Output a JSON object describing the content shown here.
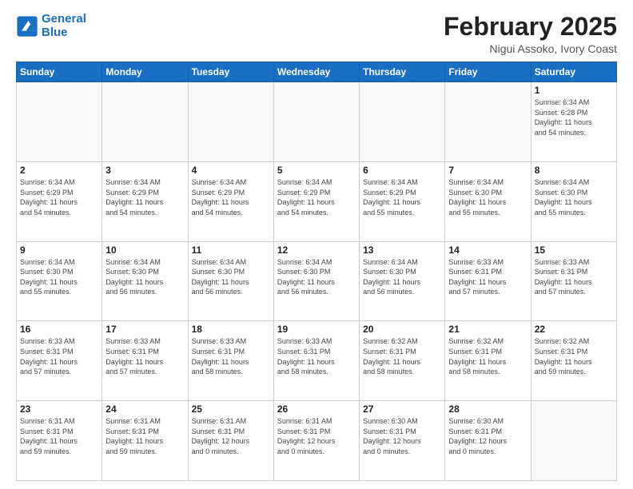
{
  "logo": {
    "line1": "General",
    "line2": "Blue"
  },
  "header": {
    "month": "February 2025",
    "location": "Nigui Assoko, Ivory Coast"
  },
  "weekdays": [
    "Sunday",
    "Monday",
    "Tuesday",
    "Wednesday",
    "Thursday",
    "Friday",
    "Saturday"
  ],
  "weeks": [
    [
      {
        "day": "",
        "info": ""
      },
      {
        "day": "",
        "info": ""
      },
      {
        "day": "",
        "info": ""
      },
      {
        "day": "",
        "info": ""
      },
      {
        "day": "",
        "info": ""
      },
      {
        "day": "",
        "info": ""
      },
      {
        "day": "1",
        "info": "Sunrise: 6:34 AM\nSunset: 6:28 PM\nDaylight: 11 hours\nand 54 minutes."
      }
    ],
    [
      {
        "day": "2",
        "info": "Sunrise: 6:34 AM\nSunset: 6:29 PM\nDaylight: 11 hours\nand 54 minutes."
      },
      {
        "day": "3",
        "info": "Sunrise: 6:34 AM\nSunset: 6:29 PM\nDaylight: 11 hours\nand 54 minutes."
      },
      {
        "day": "4",
        "info": "Sunrise: 6:34 AM\nSunset: 6:29 PM\nDaylight: 11 hours\nand 54 minutes."
      },
      {
        "day": "5",
        "info": "Sunrise: 6:34 AM\nSunset: 6:29 PM\nDaylight: 11 hours\nand 54 minutes."
      },
      {
        "day": "6",
        "info": "Sunrise: 6:34 AM\nSunset: 6:29 PM\nDaylight: 11 hours\nand 55 minutes."
      },
      {
        "day": "7",
        "info": "Sunrise: 6:34 AM\nSunset: 6:30 PM\nDaylight: 11 hours\nand 55 minutes."
      },
      {
        "day": "8",
        "info": "Sunrise: 6:34 AM\nSunset: 6:30 PM\nDaylight: 11 hours\nand 55 minutes."
      }
    ],
    [
      {
        "day": "9",
        "info": "Sunrise: 6:34 AM\nSunset: 6:30 PM\nDaylight: 11 hours\nand 55 minutes."
      },
      {
        "day": "10",
        "info": "Sunrise: 6:34 AM\nSunset: 6:30 PM\nDaylight: 11 hours\nand 56 minutes."
      },
      {
        "day": "11",
        "info": "Sunrise: 6:34 AM\nSunset: 6:30 PM\nDaylight: 11 hours\nand 56 minutes."
      },
      {
        "day": "12",
        "info": "Sunrise: 6:34 AM\nSunset: 6:30 PM\nDaylight: 11 hours\nand 56 minutes."
      },
      {
        "day": "13",
        "info": "Sunrise: 6:34 AM\nSunset: 6:30 PM\nDaylight: 11 hours\nand 56 minutes."
      },
      {
        "day": "14",
        "info": "Sunrise: 6:33 AM\nSunset: 6:31 PM\nDaylight: 11 hours\nand 57 minutes."
      },
      {
        "day": "15",
        "info": "Sunrise: 6:33 AM\nSunset: 6:31 PM\nDaylight: 11 hours\nand 57 minutes."
      }
    ],
    [
      {
        "day": "16",
        "info": "Sunrise: 6:33 AM\nSunset: 6:31 PM\nDaylight: 11 hours\nand 57 minutes."
      },
      {
        "day": "17",
        "info": "Sunrise: 6:33 AM\nSunset: 6:31 PM\nDaylight: 11 hours\nand 57 minutes."
      },
      {
        "day": "18",
        "info": "Sunrise: 6:33 AM\nSunset: 6:31 PM\nDaylight: 11 hours\nand 58 minutes."
      },
      {
        "day": "19",
        "info": "Sunrise: 6:33 AM\nSunset: 6:31 PM\nDaylight: 11 hours\nand 58 minutes."
      },
      {
        "day": "20",
        "info": "Sunrise: 6:32 AM\nSunset: 6:31 PM\nDaylight: 11 hours\nand 58 minutes."
      },
      {
        "day": "21",
        "info": "Sunrise: 6:32 AM\nSunset: 6:31 PM\nDaylight: 11 hours\nand 58 minutes."
      },
      {
        "day": "22",
        "info": "Sunrise: 6:32 AM\nSunset: 6:31 PM\nDaylight: 11 hours\nand 59 minutes."
      }
    ],
    [
      {
        "day": "23",
        "info": "Sunrise: 6:31 AM\nSunset: 6:31 PM\nDaylight: 11 hours\nand 59 minutes."
      },
      {
        "day": "24",
        "info": "Sunrise: 6:31 AM\nSunset: 6:31 PM\nDaylight: 11 hours\nand 59 minutes."
      },
      {
        "day": "25",
        "info": "Sunrise: 6:31 AM\nSunset: 6:31 PM\nDaylight: 12 hours\nand 0 minutes."
      },
      {
        "day": "26",
        "info": "Sunrise: 6:31 AM\nSunset: 6:31 PM\nDaylight: 12 hours\nand 0 minutes."
      },
      {
        "day": "27",
        "info": "Sunrise: 6:30 AM\nSunset: 6:31 PM\nDaylight: 12 hours\nand 0 minutes."
      },
      {
        "day": "28",
        "info": "Sunrise: 6:30 AM\nSunset: 6:31 PM\nDaylight: 12 hours\nand 0 minutes."
      },
      {
        "day": "",
        "info": ""
      }
    ]
  ]
}
